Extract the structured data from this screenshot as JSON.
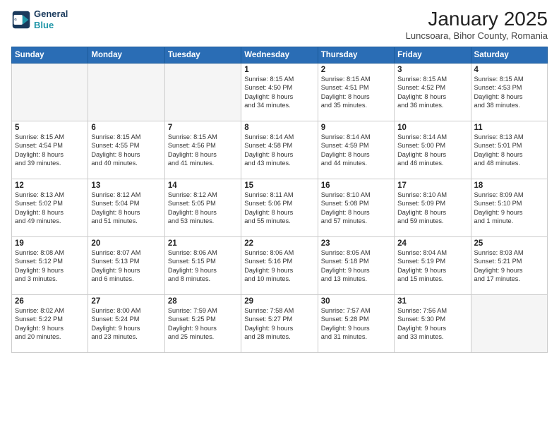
{
  "logo": {
    "line1": "General",
    "line2": "Blue"
  },
  "title": "January 2025",
  "subtitle": "Luncsoara, Bihor County, Romania",
  "days_of_week": [
    "Sunday",
    "Monday",
    "Tuesday",
    "Wednesday",
    "Thursday",
    "Friday",
    "Saturday"
  ],
  "weeks": [
    [
      {
        "num": "",
        "info": ""
      },
      {
        "num": "",
        "info": ""
      },
      {
        "num": "",
        "info": ""
      },
      {
        "num": "1",
        "info": "Sunrise: 8:15 AM\nSunset: 4:50 PM\nDaylight: 8 hours\nand 34 minutes."
      },
      {
        "num": "2",
        "info": "Sunrise: 8:15 AM\nSunset: 4:51 PM\nDaylight: 8 hours\nand 35 minutes."
      },
      {
        "num": "3",
        "info": "Sunrise: 8:15 AM\nSunset: 4:52 PM\nDaylight: 8 hours\nand 36 minutes."
      },
      {
        "num": "4",
        "info": "Sunrise: 8:15 AM\nSunset: 4:53 PM\nDaylight: 8 hours\nand 38 minutes."
      }
    ],
    [
      {
        "num": "5",
        "info": "Sunrise: 8:15 AM\nSunset: 4:54 PM\nDaylight: 8 hours\nand 39 minutes."
      },
      {
        "num": "6",
        "info": "Sunrise: 8:15 AM\nSunset: 4:55 PM\nDaylight: 8 hours\nand 40 minutes."
      },
      {
        "num": "7",
        "info": "Sunrise: 8:15 AM\nSunset: 4:56 PM\nDaylight: 8 hours\nand 41 minutes."
      },
      {
        "num": "8",
        "info": "Sunrise: 8:14 AM\nSunset: 4:58 PM\nDaylight: 8 hours\nand 43 minutes."
      },
      {
        "num": "9",
        "info": "Sunrise: 8:14 AM\nSunset: 4:59 PM\nDaylight: 8 hours\nand 44 minutes."
      },
      {
        "num": "10",
        "info": "Sunrise: 8:14 AM\nSunset: 5:00 PM\nDaylight: 8 hours\nand 46 minutes."
      },
      {
        "num": "11",
        "info": "Sunrise: 8:13 AM\nSunset: 5:01 PM\nDaylight: 8 hours\nand 48 minutes."
      }
    ],
    [
      {
        "num": "12",
        "info": "Sunrise: 8:13 AM\nSunset: 5:02 PM\nDaylight: 8 hours\nand 49 minutes."
      },
      {
        "num": "13",
        "info": "Sunrise: 8:12 AM\nSunset: 5:04 PM\nDaylight: 8 hours\nand 51 minutes."
      },
      {
        "num": "14",
        "info": "Sunrise: 8:12 AM\nSunset: 5:05 PM\nDaylight: 8 hours\nand 53 minutes."
      },
      {
        "num": "15",
        "info": "Sunrise: 8:11 AM\nSunset: 5:06 PM\nDaylight: 8 hours\nand 55 minutes."
      },
      {
        "num": "16",
        "info": "Sunrise: 8:10 AM\nSunset: 5:08 PM\nDaylight: 8 hours\nand 57 minutes."
      },
      {
        "num": "17",
        "info": "Sunrise: 8:10 AM\nSunset: 5:09 PM\nDaylight: 8 hours\nand 59 minutes."
      },
      {
        "num": "18",
        "info": "Sunrise: 8:09 AM\nSunset: 5:10 PM\nDaylight: 9 hours\nand 1 minute."
      }
    ],
    [
      {
        "num": "19",
        "info": "Sunrise: 8:08 AM\nSunset: 5:12 PM\nDaylight: 9 hours\nand 3 minutes."
      },
      {
        "num": "20",
        "info": "Sunrise: 8:07 AM\nSunset: 5:13 PM\nDaylight: 9 hours\nand 6 minutes."
      },
      {
        "num": "21",
        "info": "Sunrise: 8:06 AM\nSunset: 5:15 PM\nDaylight: 9 hours\nand 8 minutes."
      },
      {
        "num": "22",
        "info": "Sunrise: 8:06 AM\nSunset: 5:16 PM\nDaylight: 9 hours\nand 10 minutes."
      },
      {
        "num": "23",
        "info": "Sunrise: 8:05 AM\nSunset: 5:18 PM\nDaylight: 9 hours\nand 13 minutes."
      },
      {
        "num": "24",
        "info": "Sunrise: 8:04 AM\nSunset: 5:19 PM\nDaylight: 9 hours\nand 15 minutes."
      },
      {
        "num": "25",
        "info": "Sunrise: 8:03 AM\nSunset: 5:21 PM\nDaylight: 9 hours\nand 17 minutes."
      }
    ],
    [
      {
        "num": "26",
        "info": "Sunrise: 8:02 AM\nSunset: 5:22 PM\nDaylight: 9 hours\nand 20 minutes."
      },
      {
        "num": "27",
        "info": "Sunrise: 8:00 AM\nSunset: 5:24 PM\nDaylight: 9 hours\nand 23 minutes."
      },
      {
        "num": "28",
        "info": "Sunrise: 7:59 AM\nSunset: 5:25 PM\nDaylight: 9 hours\nand 25 minutes."
      },
      {
        "num": "29",
        "info": "Sunrise: 7:58 AM\nSunset: 5:27 PM\nDaylight: 9 hours\nand 28 minutes."
      },
      {
        "num": "30",
        "info": "Sunrise: 7:57 AM\nSunset: 5:28 PM\nDaylight: 9 hours\nand 31 minutes."
      },
      {
        "num": "31",
        "info": "Sunrise: 7:56 AM\nSunset: 5:30 PM\nDaylight: 9 hours\nand 33 minutes."
      },
      {
        "num": "",
        "info": ""
      }
    ]
  ]
}
